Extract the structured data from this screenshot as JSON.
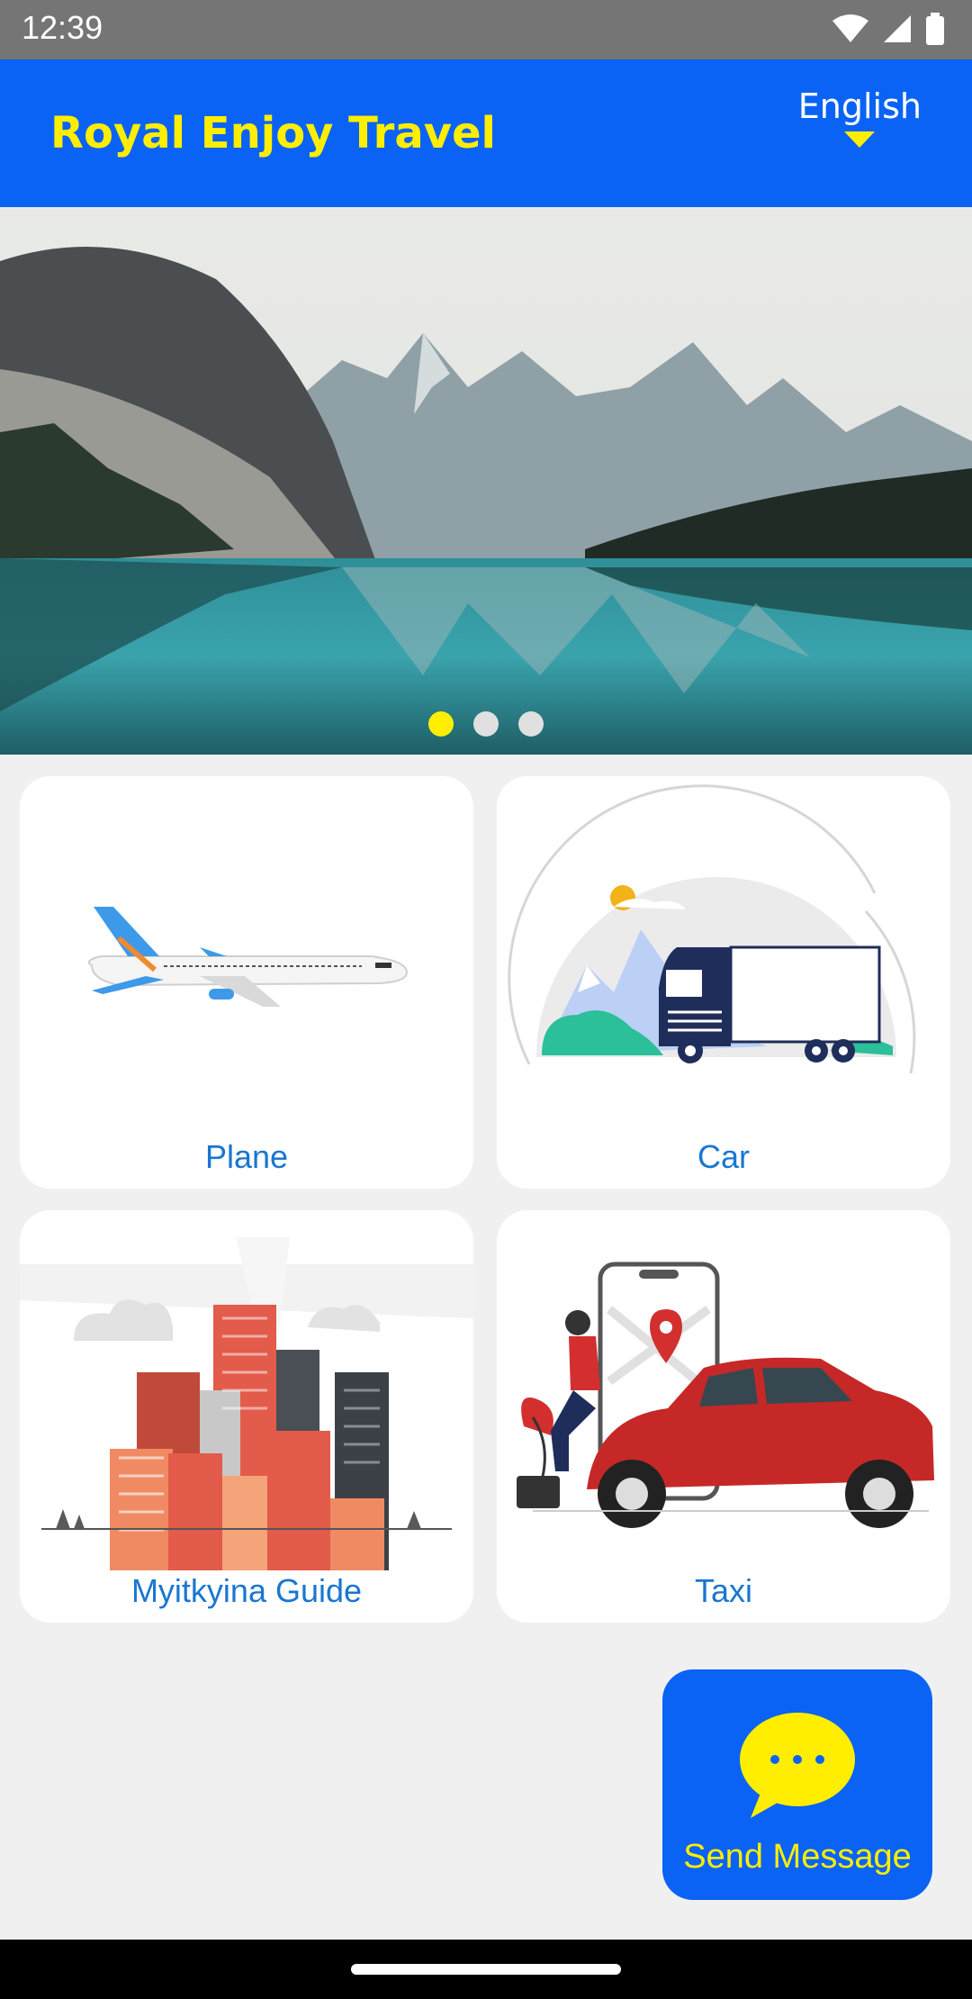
{
  "status_bar": {
    "time": "12:39",
    "icons": [
      "wifi-icon",
      "signal-icon",
      "battery-icon"
    ]
  },
  "app_bar": {
    "title": "Royal Enjoy Travel",
    "language": "English"
  },
  "banner": {
    "slide_count": 3,
    "active_slide": 1
  },
  "menu": [
    {
      "id": "plane",
      "label": "Plane",
      "illustration": "airplane"
    },
    {
      "id": "car",
      "label": "Car",
      "illustration": "truck"
    },
    {
      "id": "guide",
      "label": "Myitkyina Guide",
      "illustration": "city-buildings"
    },
    {
      "id": "taxi",
      "label": "Taxi",
      "illustration": "red-car-with-phone"
    }
  ],
  "fab": {
    "label": "Send Message",
    "icon": "chat-bubble-icon"
  },
  "colors": {
    "primary": "#0a63f5",
    "accent": "#ffee00",
    "link": "#1976d2",
    "background": "#f0f0f0"
  }
}
